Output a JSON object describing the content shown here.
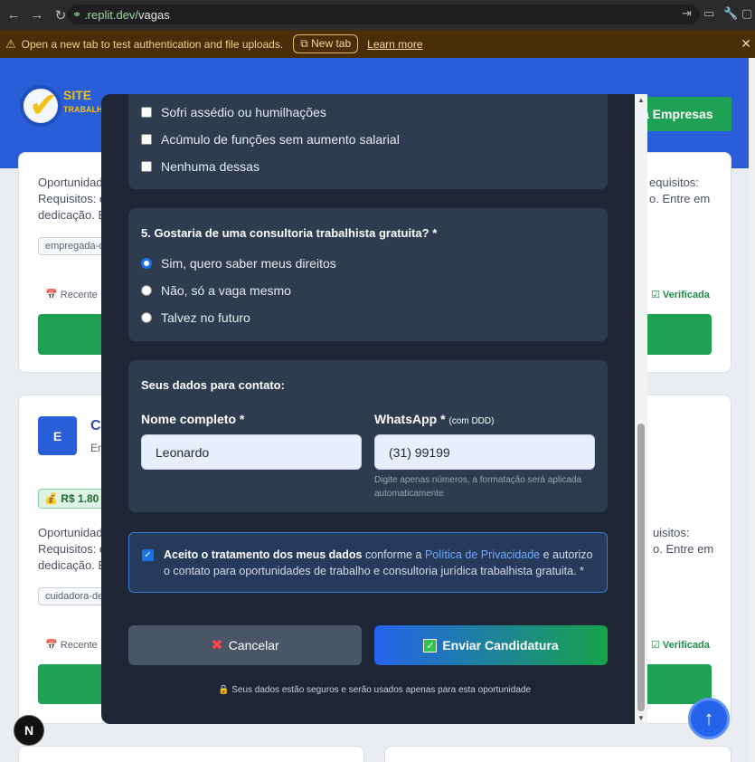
{
  "browser": {
    "url_prefix": ".replit.dev/",
    "url_path": "vagas",
    "back_icon": "←",
    "forward_icon": "→",
    "reload_icon": "↻"
  },
  "banner": {
    "message": "Open a new tab to test authentication and file uploads.",
    "new_tab": "New tab",
    "learn_more": "Learn more"
  },
  "site": {
    "logo_text_1": "SITE",
    "logo_text_2": "TRABALHI",
    "companies_button": "a Empresas"
  },
  "background_cards": {
    "desc_a_1": "Oportunidad",
    "desc_a_2": "Requisitos: e",
    "desc_a_3": "dedicação. E",
    "desc_b_1": "equisitos:",
    "desc_b_2": "o. Entre em",
    "tag_a": "empregada-d",
    "recente": "Recente",
    "verificada": "Verificada",
    "avatar_letter": "E",
    "name_frag": "Cu",
    "sub_frag": "En",
    "salary": "R$ 1.80",
    "desc_c_1": "Oportunidad",
    "desc_c_2": "Requisitos: e",
    "desc_c_3": "dedicação. E",
    "desc_d_1": "uisitos:",
    "desc_d_2": "o. Entre em",
    "tag_b": "cuidadora-de"
  },
  "modal": {
    "q4_options": [
      "Sofri assédio ou humilhações",
      "Acúmulo de funções sem aumento salarial",
      "Nenhuma dessas"
    ],
    "q5_title": "5. Gostaria de uma consultoria trabalhista gratuita? *",
    "q5_options": [
      "Sim, quero saber meus direitos",
      "Não, só a vaga mesmo",
      "Talvez no futuro"
    ],
    "contact_title": "Seus dados para contato:",
    "name_label": "Nome completo *",
    "name_value": "Leonardo",
    "whatsapp_label": "WhatsApp *",
    "whatsapp_hint_small": "(com DDD)",
    "whatsapp_value": "(31) 99199",
    "whatsapp_hint": "Digite apenas números, a formatação será aplicada automaticamente",
    "consent_bold": "Aceito o tratamento dos meus dados",
    "consent_mid": " conforme a ",
    "consent_link": "Política de Privacidade",
    "consent_rest": " e autorizo o contato para oportunidades de trabalho e consultoria jurídica trabalhista gratuita. *",
    "cancel": "Cancelar",
    "submit": "Enviar Candidatura",
    "safe_note": "Seus dados estão seguros e serão usados apenas para esta oportunidade"
  },
  "fab_icon": "↑",
  "n_badge": "N"
}
